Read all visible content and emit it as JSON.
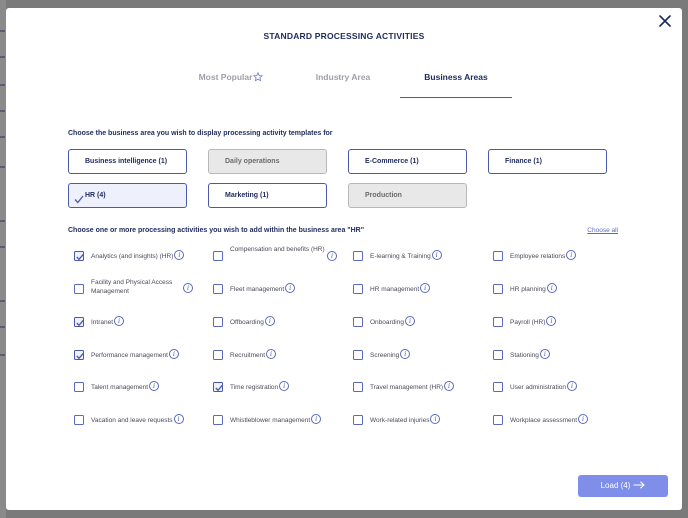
{
  "dialog": {
    "title": "STANDARD PROCESSING ACTIVITIES",
    "tabs": [
      {
        "label": "Most Popular",
        "active": false,
        "icon": "star-icon"
      },
      {
        "label": "Industry Area",
        "active": false
      },
      {
        "label": "Business Areas",
        "active": true
      }
    ],
    "area_prompt": "Choose the business area you wish to display processing activity templates for",
    "areas": [
      {
        "label": "Business intelligence (1)",
        "state": "enabled"
      },
      {
        "label": "Daily operations",
        "state": "disabled"
      },
      {
        "label": "E-Commerce (1)",
        "state": "enabled"
      },
      {
        "label": "Finance (1)",
        "state": "enabled"
      },
      {
        "label": "HR (4)",
        "state": "selected"
      },
      {
        "label": "Marketing (1)",
        "state": "enabled"
      },
      {
        "label": "Production",
        "state": "disabled"
      }
    ],
    "activity_prompt": "Choose one or more processing activities you wish to add within the business area \"HR\"",
    "choose_all": "Choose all",
    "activities": [
      {
        "label": "Analytics (and insights) (HR)",
        "checked": true
      },
      {
        "label": "Compensation and benefits (HR)",
        "checked": false
      },
      {
        "label": "E-learning & Training",
        "checked": false
      },
      {
        "label": "Employee relations",
        "checked": false
      },
      {
        "label": "Facility and Physical Access Management",
        "checked": false
      },
      {
        "label": "Fleet management",
        "checked": false
      },
      {
        "label": "HR management",
        "checked": false
      },
      {
        "label": "HR planning",
        "checked": false
      },
      {
        "label": "Intranet",
        "checked": true
      },
      {
        "label": "Offboarding",
        "checked": false
      },
      {
        "label": "Onboarding",
        "checked": false
      },
      {
        "label": "Payroll (HR)",
        "checked": false
      },
      {
        "label": "Performance management",
        "checked": true
      },
      {
        "label": "Recruitment",
        "checked": false
      },
      {
        "label": "Screening",
        "checked": false
      },
      {
        "label": "Stationing",
        "checked": false
      },
      {
        "label": "Talent management",
        "checked": false
      },
      {
        "label": "Time registration",
        "checked": true
      },
      {
        "label": "Travel management (HR)",
        "checked": false
      },
      {
        "label": "User administration",
        "checked": false
      },
      {
        "label": "Vacation and leave requests",
        "checked": false
      },
      {
        "label": "Whistleblower management",
        "checked": false
      },
      {
        "label": "Work-related injuries",
        "checked": false
      },
      {
        "label": "Workplace assessment",
        "checked": false
      }
    ],
    "load_button": "Load (4)",
    "colors": {
      "accent": "#4a5aa8",
      "title": "#1f2a5c",
      "load_bg": "#7f8ee8",
      "disabled_bg": "#e8e8e8"
    }
  }
}
